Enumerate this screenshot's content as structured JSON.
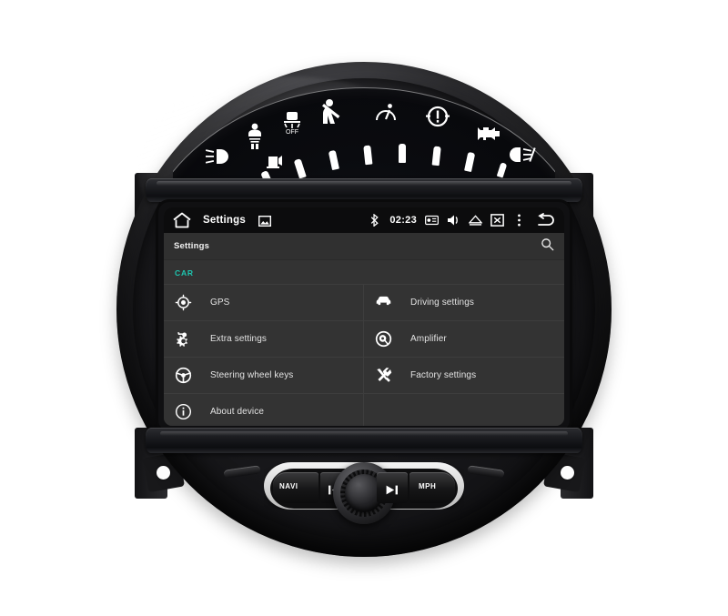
{
  "device": {
    "name": "mini-cooper-round-head-unit",
    "body_color": "#1a1a1d"
  },
  "cluster": {
    "telltales": [
      {
        "name": "front-fog-lamp-icon",
        "glyph": "☲D"
      },
      {
        "name": "airbag-passenger-icon",
        "glyph": "airbag"
      },
      {
        "name": "fuel-low-icon",
        "glyph": "fuel"
      },
      {
        "name": "dsc-off-icon",
        "glyph": "DSC",
        "sub": "OFF"
      },
      {
        "name": "seatbelt-icon",
        "glyph": "belt"
      },
      {
        "name": "speed-limit-icon",
        "glyph": "gauge"
      },
      {
        "name": "brake-warning-icon",
        "glyph": "(!)"
      },
      {
        "name": "check-engine-icon",
        "glyph": "engine"
      },
      {
        "name": "rear-fog-lamp-icon",
        "glyph": "D‡"
      }
    ],
    "tick_count": 10
  },
  "statusbar": {
    "home_icon": "home-icon",
    "title": "Settings",
    "gallery_icon": "picture-icon",
    "bluetooth_icon": "bluetooth-icon",
    "clock": "02:23",
    "radio_icon": "radio-icon",
    "volume_icon": "volume-icon",
    "eject_icon": "eject-icon",
    "screen_off_icon": "screen-off-icon",
    "overflow_icon": "more-vertical-icon",
    "back_icon": "back-arrow-icon"
  },
  "titlebar": {
    "title": "Settings",
    "search_icon": "search-icon"
  },
  "content": {
    "category": "CAR",
    "items": [
      {
        "icon": "gps-target-icon",
        "label": "GPS"
      },
      {
        "icon": "car-icon",
        "label": "Driving settings"
      },
      {
        "icon": "extra-settings-gear-icon",
        "label": "Extra settings"
      },
      {
        "icon": "amplifier-speaker-icon",
        "label": "Amplifier"
      },
      {
        "icon": "steering-wheel-icon",
        "label": "Steering wheel keys"
      },
      {
        "icon": "wrench-screwdriver-icon",
        "label": "Factory settings"
      },
      {
        "icon": "info-circle-icon",
        "label": "About device"
      }
    ],
    "accent_color": "#1ec6b0",
    "background_color": "#333333"
  },
  "controls": {
    "navi_label": "NAVI",
    "prev_icon": "skip-previous-icon",
    "next_icon": "skip-next-icon",
    "mph_label": "MPH",
    "knob": "rotary-volume-knob"
  }
}
